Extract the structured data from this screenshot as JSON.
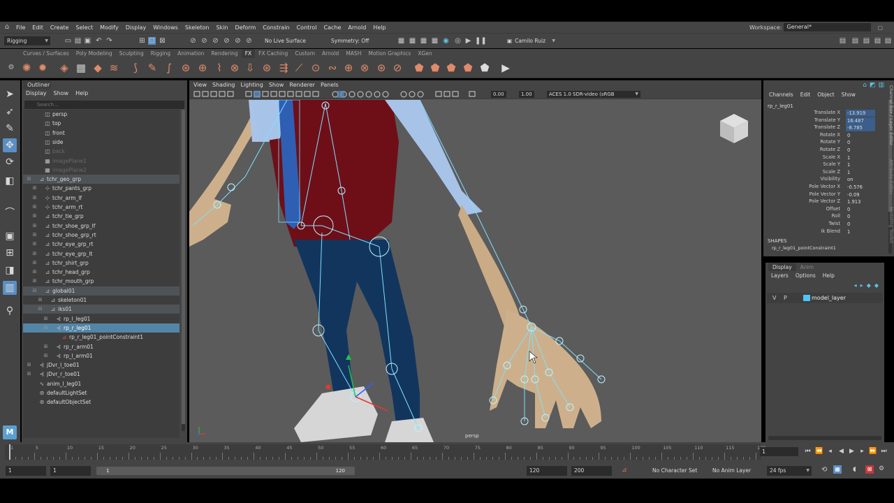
{
  "menubar": {
    "items": [
      "File",
      "Edit",
      "Create",
      "Select",
      "Modify",
      "Display",
      "Windows",
      "Skeleton",
      "Skin",
      "Deform",
      "Constrain",
      "Control",
      "Cache",
      "Arnold",
      "Help"
    ],
    "workspace_label": "Workspace:",
    "workspace_value": "General*"
  },
  "statusline": {
    "mode": "Rigging",
    "live_surface": "No Live Surface",
    "symmetry": "Symmetry: Off",
    "user": "Camilo Ruiz"
  },
  "shelf_tabs": [
    "Curves / Surfaces",
    "Poly Modeling",
    "Sculpting",
    "Rigging",
    "Animation",
    "Rendering",
    "FX",
    "FX Caching",
    "Custom",
    "Arnold",
    "MASH",
    "Motion Graphics",
    "XGen"
  ],
  "shelf_active_tab": "FX",
  "outliner": {
    "title": "Outliner",
    "menus": [
      "Display",
      "Show",
      "Help"
    ],
    "search_placeholder": "Search...",
    "rows": [
      {
        "label": "persp",
        "indent": 1,
        "icon": "camera-icon",
        "dim": false
      },
      {
        "label": "top",
        "indent": 1,
        "icon": "camera-icon",
        "dim": false
      },
      {
        "label": "front",
        "indent": 1,
        "icon": "camera-icon",
        "dim": false
      },
      {
        "label": "side",
        "indent": 1,
        "icon": "camera-icon",
        "dim": false
      },
      {
        "label": "back",
        "indent": 1,
        "icon": "camera-icon",
        "dim": true
      },
      {
        "label": "imagePlane1",
        "indent": 1,
        "icon": "image-plane-icon",
        "dim": true
      },
      {
        "label": "imagePlane2",
        "indent": 1,
        "icon": "image-plane-icon",
        "dim": true
      },
      {
        "label": "tchr_geo_grp",
        "indent": 0,
        "icon": "group-icon",
        "exp": "−",
        "hl": true
      },
      {
        "label": "tchr_pants_grp",
        "indent": 1,
        "icon": "transform-icon",
        "exp": "+"
      },
      {
        "label": "tchr_arm_lf",
        "indent": 1,
        "icon": "transform-icon",
        "exp": "+"
      },
      {
        "label": "tchr_arm_rt",
        "indent": 1,
        "icon": "transform-icon",
        "exp": "+"
      },
      {
        "label": "tchr_tie_grp",
        "indent": 1,
        "icon": "group-icon",
        "exp": "+"
      },
      {
        "label": "tchr_shoe_grp_lf",
        "indent": 1,
        "icon": "group-icon",
        "exp": "+"
      },
      {
        "label": "tchr_shoe_grp_rt",
        "indent": 1,
        "icon": "group-icon",
        "exp": "+"
      },
      {
        "label": "tchr_eye_grp_rt",
        "indent": 1,
        "icon": "group-icon",
        "exp": "+"
      },
      {
        "label": "tchr_eye_grp_lt",
        "indent": 1,
        "icon": "group-icon",
        "exp": "+"
      },
      {
        "label": "tchr_shirt_grp",
        "indent": 1,
        "icon": "group-icon",
        "exp": "+"
      },
      {
        "label": "tchr_head_grp",
        "indent": 1,
        "icon": "group-icon",
        "exp": "+"
      },
      {
        "label": "tchr_mouth_grp",
        "indent": 1,
        "icon": "group-icon",
        "exp": "+"
      },
      {
        "label": "global01",
        "indent": 1,
        "icon": "group-icon",
        "exp": "−",
        "hl": true
      },
      {
        "label": "skeleton01",
        "indent": 2,
        "icon": "group-icon",
        "exp": "+"
      },
      {
        "label": "iks01",
        "indent": 2,
        "icon": "group-icon",
        "exp": "−",
        "hl": true
      },
      {
        "label": "rp_l_leg01",
        "indent": 3,
        "icon": "ik-handle-icon",
        "exp": "+"
      },
      {
        "label": "rp_r_leg01",
        "indent": 3,
        "icon": "ik-handle-icon",
        "exp": "−",
        "sel": true
      },
      {
        "label": "rp_r_leg01_pointConstraint1",
        "indent": 4,
        "icon": "constraint-icon"
      },
      {
        "label": "rp_r_arm01",
        "indent": 3,
        "icon": "ik-handle-icon",
        "exp": "+"
      },
      {
        "label": "rp_l_arm01",
        "indent": 3,
        "icon": "ik-handle-icon",
        "exp": "+"
      },
      {
        "label": "jDvr_l_toe01",
        "indent": 0,
        "icon": "joint-icon",
        "exp": "+"
      },
      {
        "label": "jDvr_r_toe01",
        "indent": 0,
        "icon": "joint-icon",
        "exp": "+"
      },
      {
        "label": "anim_l_leg01",
        "indent": 0,
        "icon": "curve-icon"
      },
      {
        "label": "defaultLightSet",
        "indent": 0,
        "icon": "set-icon"
      },
      {
        "label": "defaultObjectSet",
        "indent": 0,
        "icon": "set-icon"
      }
    ]
  },
  "viewport": {
    "menus": [
      "View",
      "Shading",
      "Lighting",
      "Show",
      "Renderer",
      "Panels"
    ],
    "near_value": "0.00",
    "far_value": "1.00",
    "color_space": "ACES 1.0 SDR-video (sRGB",
    "camera_label": "persp"
  },
  "channelbox": {
    "menus": [
      "Channels",
      "Edit",
      "Object",
      "Show"
    ],
    "node": "rp_r_leg01",
    "attributes": [
      {
        "name": "Translate X",
        "value": "-13.919",
        "key": true
      },
      {
        "name": "Translate Y",
        "value": "16.487",
        "key": true
      },
      {
        "name": "Translate Z",
        "value": "-8.785",
        "key": true
      },
      {
        "name": "Rotate X",
        "value": "0"
      },
      {
        "name": "Rotate Y",
        "value": "0"
      },
      {
        "name": "Rotate Z",
        "value": "0"
      },
      {
        "name": "Scale X",
        "value": "1"
      },
      {
        "name": "Scale Y",
        "value": "1"
      },
      {
        "name": "Scale Z",
        "value": "1"
      },
      {
        "name": "Visibility",
        "value": "on"
      },
      {
        "name": "Pole Vector X",
        "value": "-0.576"
      },
      {
        "name": "Pole Vector Y",
        "value": "-0.09"
      },
      {
        "name": "Pole Vector Z",
        "value": "1.913"
      },
      {
        "name": "Offset",
        "value": "0"
      },
      {
        "name": "Roll",
        "value": "0"
      },
      {
        "name": "Twist",
        "value": "0"
      },
      {
        "name": "Ik Blend",
        "value": "1"
      }
    ],
    "shapes_title": "SHAPES",
    "shapes_node": "rp_r_leg01_pointConstraint1",
    "side_tabs": [
      "Channel Box / Layer Editor",
      "Attribute Editor",
      "Modeling Toolkit"
    ]
  },
  "layer_editor": {
    "tabs": [
      "Display",
      "Anim"
    ],
    "menus": [
      "Layers",
      "Options",
      "Help"
    ],
    "layer": {
      "v": "V",
      "p": "P",
      "name": "model_layer",
      "color": "#4fc3f7"
    }
  },
  "timeline": {
    "ticks": [
      1,
      5,
      10,
      15,
      20,
      25,
      30,
      35,
      40,
      45,
      50,
      55,
      60,
      65,
      70,
      75,
      80,
      85,
      90,
      95,
      100,
      105,
      110,
      115,
      120
    ],
    "current_frame": "1"
  },
  "range": {
    "start": "1",
    "playback_start": "1",
    "range_start": "1",
    "range_end": "120",
    "playback_end": "120",
    "end": "200",
    "character_set": "No Character Set",
    "anim_layer": "No Anim Layer",
    "fps": "24 fps"
  }
}
